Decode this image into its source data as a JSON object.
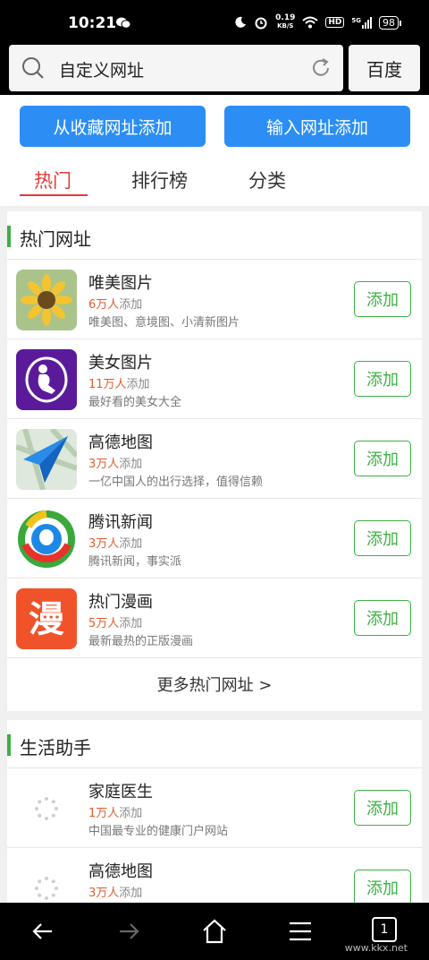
{
  "status_bar": {
    "time": "10:21",
    "net_speed_value": "0.19",
    "net_speed_unit": "KB/S",
    "hd": "HD",
    "signal": "5G",
    "battery": "98"
  },
  "search": {
    "query": "自定义网址",
    "engine": "百度"
  },
  "actions": {
    "add_from_favorites": "从收藏网址添加",
    "add_by_url": "输入网址添加"
  },
  "tabs": [
    {
      "label": "热门"
    },
    {
      "label": "排行榜"
    },
    {
      "label": "分类"
    }
  ],
  "hot_section": {
    "title": "热门网址",
    "items": [
      {
        "name": "唯美图片",
        "users": "6万人",
        "users_suffix": "添加",
        "desc": "唯美图、意境图、小清新图片",
        "add": "添加"
      },
      {
        "name": "美女图片",
        "users": "11万人",
        "users_suffix": "添加",
        "desc": "最好看的美女大全",
        "add": "添加"
      },
      {
        "name": "高德地图",
        "users": "3万人",
        "users_suffix": "添加",
        "desc": "一亿中国人的出行选择，值得信赖",
        "add": "添加"
      },
      {
        "name": "腾讯新闻",
        "users": "3万人",
        "users_suffix": "添加",
        "desc": "腾讯新闻，事实派",
        "add": "添加"
      },
      {
        "name": "热门漫画",
        "users": "5万人",
        "users_suffix": "添加",
        "desc": "最新最热的正版漫画",
        "add": "添加"
      }
    ],
    "more": "更多热门网址 >"
  },
  "life_section": {
    "title": "生活助手",
    "items": [
      {
        "name": "家庭医生",
        "users": "1万人",
        "users_suffix": "添加",
        "desc": "中国最专业的健康门户网站",
        "add": "添加"
      },
      {
        "name": "高德地图",
        "users": "3万人",
        "users_suffix": "添加",
        "desc": "",
        "add": "添加"
      }
    ]
  },
  "navbar": {
    "tab_count": "1"
  },
  "watermark": "www.kkx.net",
  "colors": {
    "accent_blue": "#2c8ef4",
    "add_green": "#3cb043",
    "active_tab_red": "#e53a3a",
    "user_count_orange": "#e35b2c"
  },
  "icons": {
    "row_1": "sunflower-icon",
    "row_2": "beauty-silhouette-icon",
    "row_3": "paper-plane-map-icon",
    "row_4": "tencent-news-icon",
    "row_5": "manhua-icon",
    "loading": "loading-spinner-icon"
  }
}
